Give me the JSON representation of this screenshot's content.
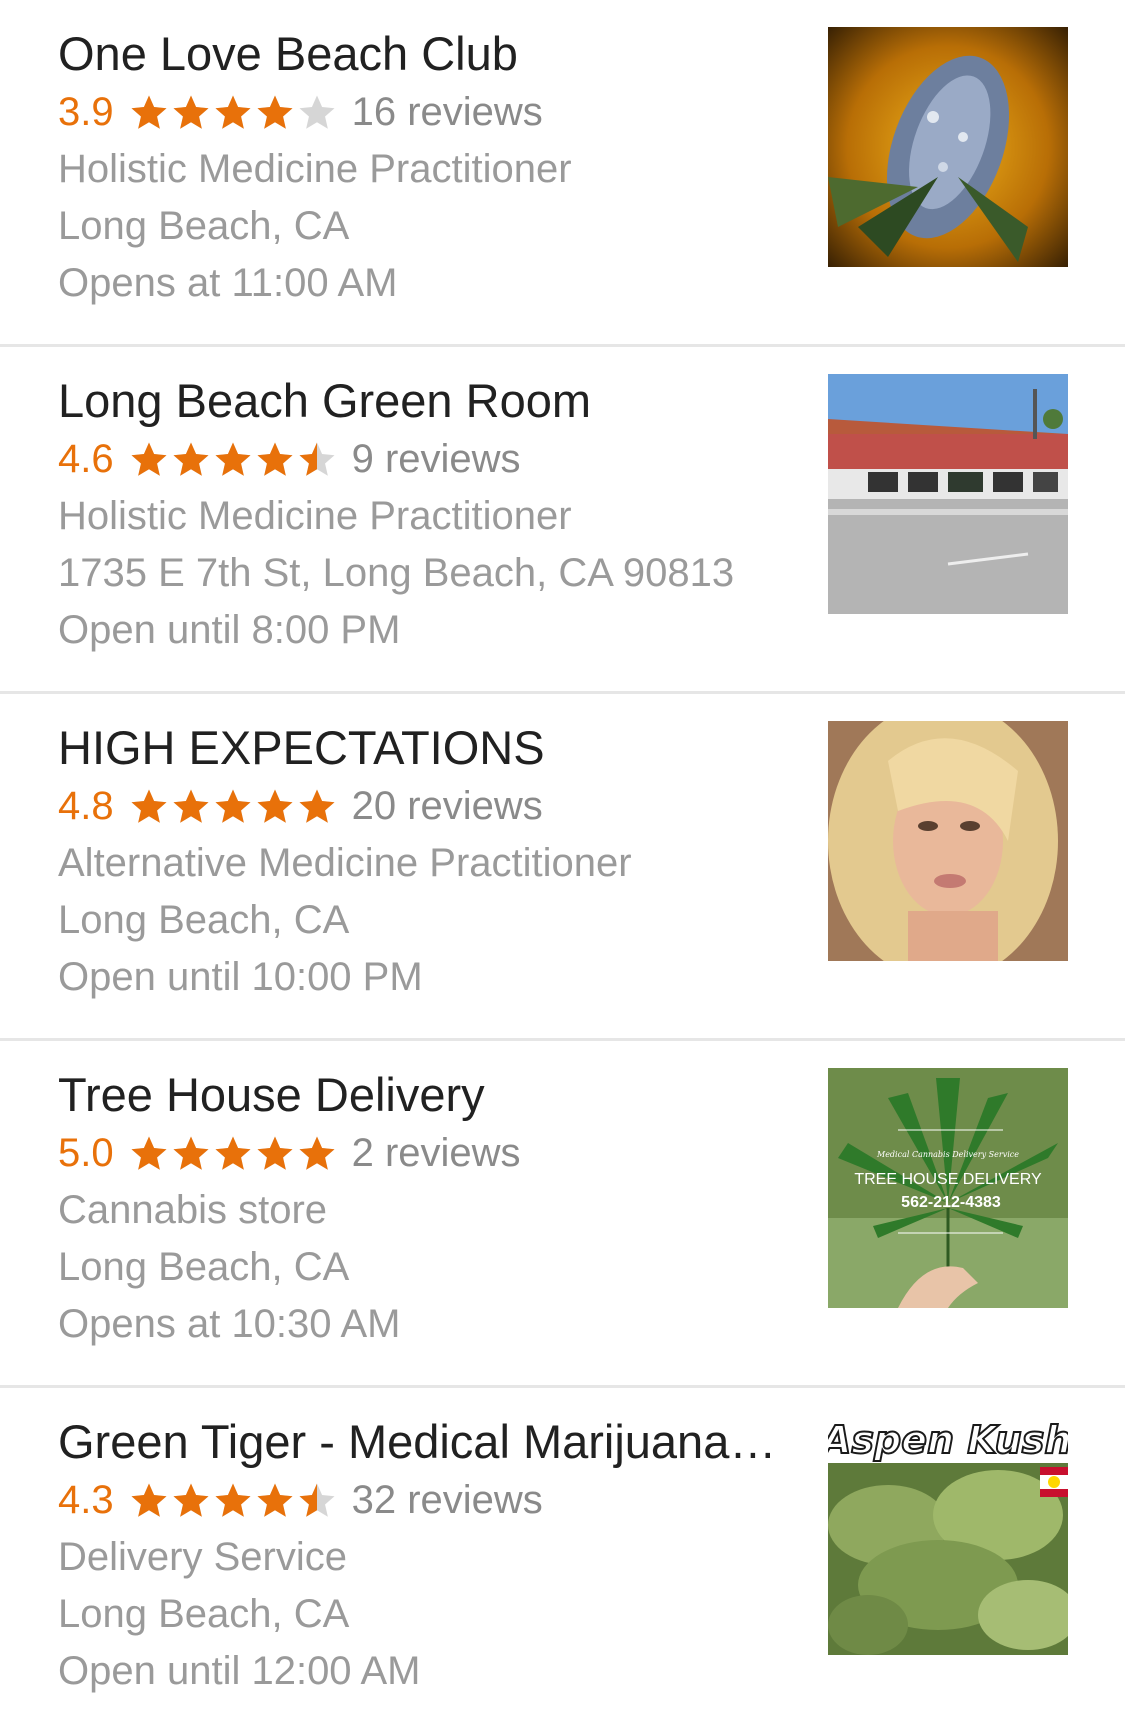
{
  "colors": {
    "rating": "#e8710a",
    "star_filled": "#e8710a",
    "star_empty": "#d6d6d6",
    "title": "#212121",
    "secondary": "#9a9a9a",
    "divider": "#e6e6e6"
  },
  "results": [
    {
      "name": "One Love Beach Club",
      "rating": "3.9",
      "stars_value": 3.9,
      "reviews": "16 reviews",
      "category": "Holistic Medicine Practitioner",
      "address": "Long Beach, CA",
      "hours": "Opens at 11:00 AM",
      "thumbnail_icon": "cannabis-bud-photo-icon"
    },
    {
      "name": "Long Beach Green Room",
      "rating": "4.6",
      "stars_value": 4.6,
      "reviews": "9 reviews",
      "category": "Holistic Medicine Practitioner",
      "address": "1735 E 7th St, Long Beach, CA 90813",
      "hours": "Open until 8:00 PM",
      "thumbnail_icon": "storefront-photo-icon"
    },
    {
      "name": "HIGH EXPECTATIONS",
      "rating": "4.8",
      "stars_value": 4.8,
      "reviews": "20 reviews",
      "category": "Alternative Medicine Practitioner",
      "address": "Long Beach, CA",
      "hours": "Open until 10:00 PM",
      "thumbnail_icon": "portrait-photo-icon"
    },
    {
      "name": "Tree House Delivery",
      "rating": "5.0",
      "stars_value": 5.0,
      "reviews": "2 reviews",
      "category": "Cannabis store",
      "address": "Long Beach, CA",
      "hours": "Opens at 10:30 AM",
      "thumbnail_icon": "cannabis-leaf-logo-icon",
      "thumbnail_text": {
        "small": "Medical Cannabis Delivery Service",
        "title": "TREE HOUSE DELIVERY",
        "phone": "562-212-4383"
      }
    },
    {
      "name": "Green Tiger - Medical Marijuana ...",
      "rating": "4.3",
      "stars_value": 4.3,
      "reviews": "32 reviews",
      "category": "Delivery Service",
      "address": "Long Beach, CA",
      "hours": "Open until 12:00 AM",
      "thumbnail_icon": "aspen-kush-photo-icon",
      "thumbnail_text": {
        "title": "Aspen Kush"
      }
    }
  ]
}
